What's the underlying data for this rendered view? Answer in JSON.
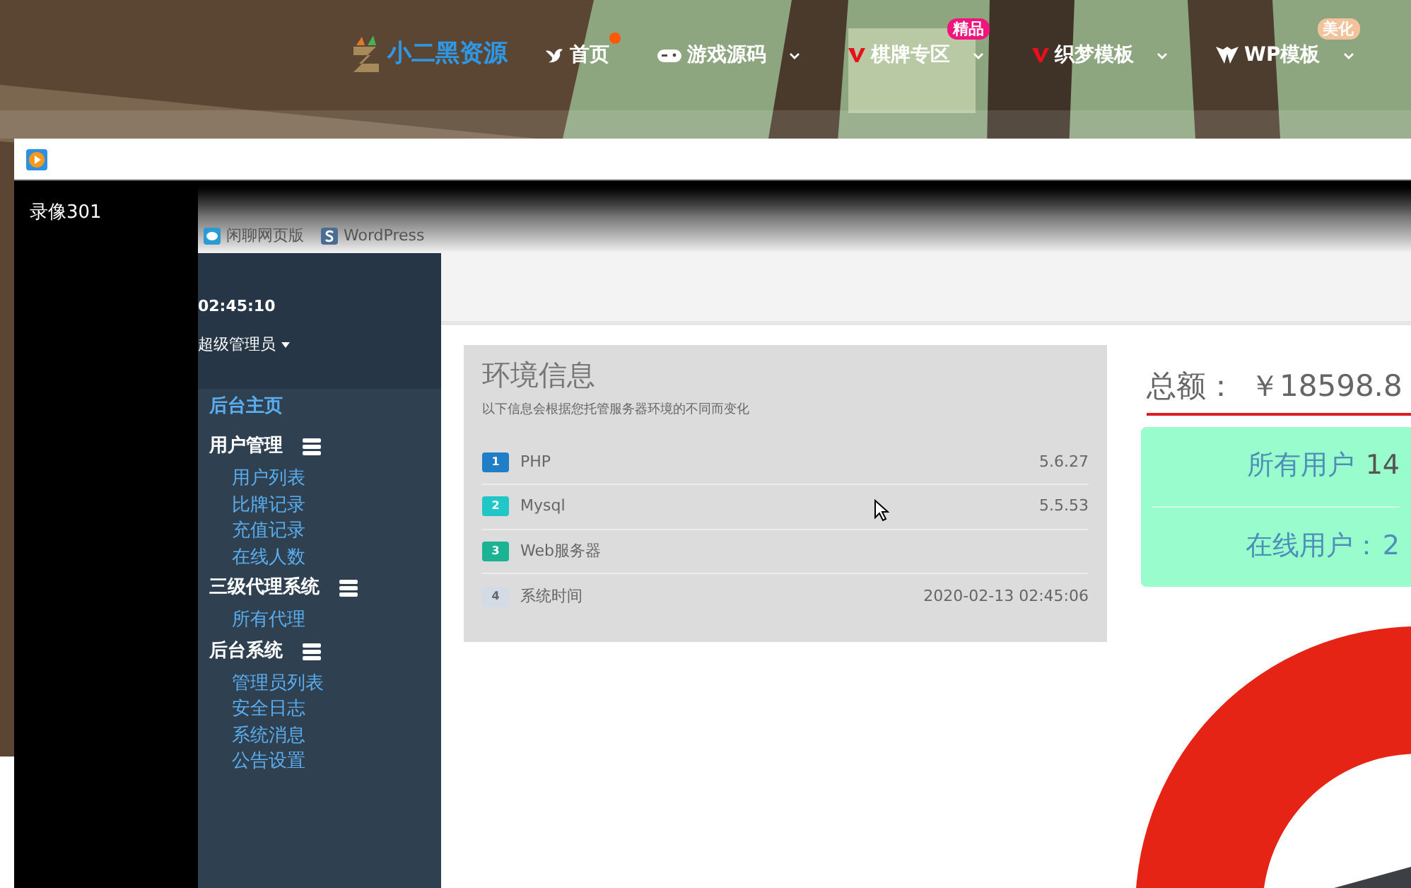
{
  "site_nav": {
    "logo": "小二黑资源",
    "items": [
      {
        "label": "首页",
        "kind": "bird",
        "dot": true,
        "dropdown": false
      },
      {
        "label": "游戏源码",
        "kind": "gamepad",
        "dot": false,
        "dropdown": true
      },
      {
        "label": "棋牌专区",
        "kind": "v",
        "dot": false,
        "dropdown": true,
        "badge": "精品",
        "color": "#f0147d"
      },
      {
        "label": "织梦模板",
        "kind": "v",
        "dot": false,
        "dropdown": true
      },
      {
        "label": "WP模板",
        "kind": "wp",
        "dot": false,
        "dropdown": true,
        "badge": "美化",
        "color": "#f2c29a"
      }
    ]
  },
  "player": {
    "recording_label": "录像301"
  },
  "browser": {
    "bookmarks": [
      {
        "label": "闲聊网页版",
        "kind": "chat"
      },
      {
        "label": "WordPress",
        "kind": "wp"
      }
    ]
  },
  "admin": {
    "clock": "02:45:10",
    "user": "超级管理员",
    "menu": [
      {
        "label": "后台主页",
        "kind": "link"
      },
      {
        "label": "用户管理",
        "kind": "group",
        "children": [
          {
            "label": "用户列表"
          },
          {
            "label": "比牌记录"
          },
          {
            "label": "充值记录"
          },
          {
            "label": "在线人数"
          }
        ]
      },
      {
        "label": "三级代理系统",
        "kind": "group",
        "children": [
          {
            "label": "所有代理"
          }
        ]
      },
      {
        "label": "后台系统",
        "kind": "group",
        "children": [
          {
            "label": "管理员列表"
          },
          {
            "label": "安全日志"
          },
          {
            "label": "系统消息"
          },
          {
            "label": "公告设置"
          }
        ]
      }
    ],
    "env": {
      "title": "环境信息",
      "subtitle": "以下信息会根据您托管服务器环境的不同而变化",
      "rows": [
        {
          "num": "1",
          "name": "PHP",
          "value": "5.6.27",
          "color": "#1f7ec6"
        },
        {
          "num": "2",
          "name": "Mysql",
          "value": "5.5.53",
          "color": "#22c6c6"
        },
        {
          "num": "3",
          "name": "Web服务器",
          "color": "#1bb394"
        },
        {
          "num": "4",
          "name": "系统时间",
          "value": "2020-02-13 02:45:06",
          "color": "#d3dce6"
        }
      ]
    },
    "stats": {
      "total_label": "总额：",
      "total_value": "￥18598.8",
      "users_label": "所有用户",
      "users_value": "14",
      "online_label": "在线用户：",
      "online_value": "2"
    }
  }
}
